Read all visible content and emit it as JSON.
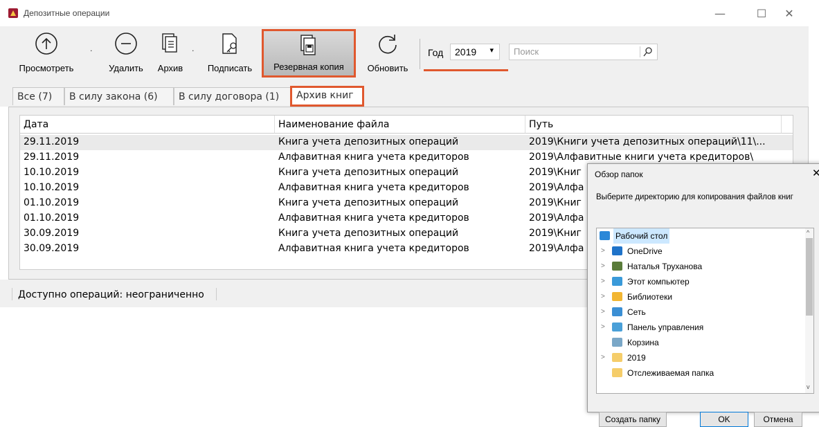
{
  "window": {
    "title": "Депозитные операции",
    "controls": [
      "—",
      "☐",
      "✕"
    ]
  },
  "toolbar": {
    "view_label": "Просмотреть",
    "delete_label": "Удалить",
    "archive_label": "Архив",
    "sign_label": "Подписать",
    "backup_label": "Резервная копия",
    "refresh_label": "Обновить",
    "dropdown_mark": "."
  },
  "filter": {
    "year_label": "Год",
    "year_value": "2019",
    "search_placeholder": "Поиск"
  },
  "colors": {
    "accent": "#e0582e",
    "selection": "#cce8ff"
  },
  "tabs": [
    {
      "label": "Все (7)"
    },
    {
      "label": "В силу закона (6)"
    },
    {
      "label": "В силу договора (1)"
    },
    {
      "label": "Архив книг"
    }
  ],
  "grid": {
    "columns": [
      "Дата",
      "Наименование файла",
      "Путь"
    ],
    "rows": [
      {
        "date": "29.11.2019",
        "name": "Книга учета депозитных операций",
        "path": "2019\\Книги учета депозитных операций\\11\\..."
      },
      {
        "date": "29.11.2019",
        "name": "Алфавитная книга учета кредиторов",
        "path": "2019\\Алфавитные книги учета кредиторов\\"
      },
      {
        "date": "10.10.2019",
        "name": "Книга учета депозитных операций",
        "path": "2019\\Книг"
      },
      {
        "date": "10.10.2019",
        "name": "Алфавитная книга учета кредиторов",
        "path": "2019\\Алфа"
      },
      {
        "date": "01.10.2019",
        "name": "Книга учета депозитных операций",
        "path": "2019\\Книг"
      },
      {
        "date": "01.10.2019",
        "name": "Алфавитная книга учета кредиторов",
        "path": "2019\\Алфа"
      },
      {
        "date": "30.09.2019",
        "name": "Книга учета депозитных операций",
        "path": "2019\\Книг"
      },
      {
        "date": "30.09.2019",
        "name": "Алфавитная книга учета кредиторов",
        "path": "2019\\Алфа"
      }
    ]
  },
  "status": {
    "text": "Доступно операций: неограниченно"
  },
  "dialog": {
    "title": "Обзор папок",
    "close": "✕",
    "prompt": "Выберите директорию для копирования файлов книг",
    "tree": [
      {
        "label": "Рабочий стол",
        "icon": "desktop-icon",
        "color": "#2b88d8",
        "expand": ""
      },
      {
        "label": "OneDrive",
        "icon": "onedrive-icon",
        "color": "#1f73c9",
        "expand": ">"
      },
      {
        "label": "Наталья Труханова",
        "icon": "user-icon",
        "color": "#5a7c3a",
        "expand": ">"
      },
      {
        "label": "Этот компьютер",
        "icon": "computer-icon",
        "color": "#3a9ad9",
        "expand": ">"
      },
      {
        "label": "Библиотеки",
        "icon": "library-icon",
        "color": "#f2b632",
        "expand": ">"
      },
      {
        "label": "Сеть",
        "icon": "network-icon",
        "color": "#3b8fd4",
        "expand": ">"
      },
      {
        "label": "Панель управления",
        "icon": "control-panel-icon",
        "color": "#4aa0d8",
        "expand": ">"
      },
      {
        "label": "Корзина",
        "icon": "recycle-bin-icon",
        "color": "#7aa7c7",
        "expand": ""
      },
      {
        "label": "2019",
        "icon": "folder-icon",
        "color": "#f5cd6a",
        "expand": ">"
      },
      {
        "label": "Отслеживаемая папка",
        "icon": "folder-icon",
        "color": "#f5cd6a",
        "expand": ""
      }
    ],
    "buttons": {
      "new_folder": "Создать папку",
      "ok": "OK",
      "cancel": "Отмена"
    }
  }
}
